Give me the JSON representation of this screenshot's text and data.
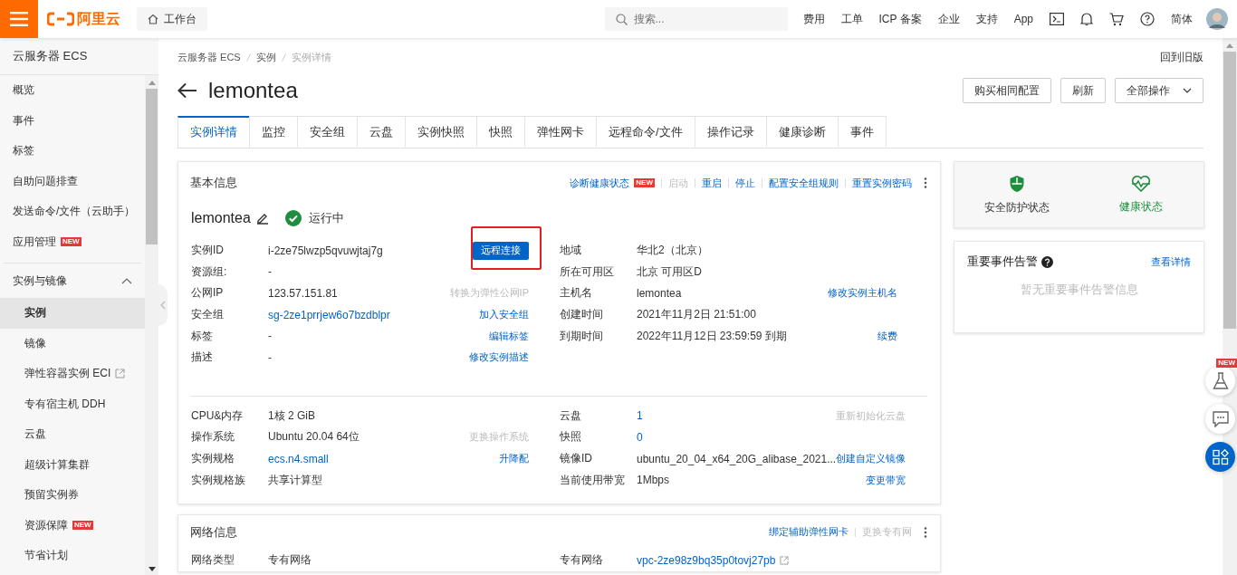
{
  "topbar": {
    "logo": "阿里云",
    "workbench": "工作台",
    "search": {
      "placeholder": "搜索..."
    },
    "links": [
      "费用",
      "工单",
      "ICP 备案",
      "企业",
      "支持",
      "App"
    ],
    "language": "简体"
  },
  "sidebar": {
    "title": "云服务器 ECS",
    "items": [
      {
        "label": "概览",
        "selected": false
      },
      {
        "label": "事件",
        "selected": false
      },
      {
        "label": "标签",
        "selected": false
      },
      {
        "label": "自助问题排查",
        "selected": false
      },
      {
        "label": "发送命令/文件（云助手）",
        "selected": false
      },
      {
        "label": "应用管理",
        "badge": "NEW",
        "selected": false
      }
    ],
    "group": {
      "label": "实例与镜像",
      "expanded": true,
      "children": [
        {
          "label": "实例",
          "selected": true
        },
        {
          "label": "镜像",
          "selected": false
        },
        {
          "label": "弹性容器实例 ECI",
          "external": true,
          "selected": false
        },
        {
          "label": "专有宿主机 DDH",
          "selected": false
        },
        {
          "label": "云盘",
          "selected": false
        },
        {
          "label": "超级计算集群",
          "selected": false
        },
        {
          "label": "预留实例券",
          "selected": false
        },
        {
          "label": "资源保障",
          "badge": "NEW",
          "selected": false
        },
        {
          "label": "节省计划",
          "selected": false
        }
      ]
    }
  },
  "breadcrumb": [
    "云服务器 ECS",
    "实例",
    "实例详情"
  ],
  "old_version_link": "回到旧版",
  "title": "lemontea",
  "header_buttons": [
    {
      "label": "购买相同配置",
      "dropdown": false
    },
    {
      "label": "刷新",
      "dropdown": false
    },
    {
      "label": "全部操作",
      "dropdown": true
    }
  ],
  "tabs": [
    {
      "label": "实例详情",
      "selected": true
    },
    {
      "label": "监控",
      "selected": false
    },
    {
      "label": "安全组",
      "selected": false
    },
    {
      "label": "云盘",
      "selected": false
    },
    {
      "label": "实例快照",
      "selected": false
    },
    {
      "label": "快照",
      "selected": false
    },
    {
      "label": "弹性网卡",
      "selected": false
    },
    {
      "label": "远程命令/文件",
      "selected": false
    },
    {
      "label": "操作记录",
      "selected": false
    },
    {
      "label": "健康诊断",
      "selected": false
    },
    {
      "label": "事件",
      "selected": false
    }
  ],
  "basic_info": {
    "title": "基本信息",
    "actions": [
      {
        "label": "诊断健康状态",
        "badge": "NEW",
        "disabled": false
      },
      {
        "label": "启动",
        "disabled": true
      },
      {
        "label": "重启",
        "disabled": false
      },
      {
        "label": "停止",
        "disabled": false
      },
      {
        "label": "配置安全组规则",
        "disabled": false
      },
      {
        "label": "重置实例密码",
        "disabled": false
      }
    ],
    "instance_name": "lemontea",
    "status": "运行中",
    "sections": [
      {
        "left": [
          {
            "label": "实例ID",
            "value": "i-2ze75lwzp5qvuwjtaj7g",
            "link": false,
            "action": {
              "kind": "button",
              "label": "远程连接",
              "highlighted": true,
              "disabled": false
            }
          },
          {
            "label": "资源组:",
            "value": "-",
            "link": false
          },
          {
            "label": "公网IP",
            "value": "123.57.151.81",
            "link": false,
            "action": {
              "kind": "link",
              "label": "转换为弹性公网IP",
              "disabled": true
            }
          },
          {
            "label": "安全组",
            "value": "sg-2ze1prrjew6o7bzdblpr",
            "link": true,
            "action": {
              "kind": "link",
              "label": "加入安全组",
              "disabled": false
            }
          },
          {
            "label": "标签",
            "value": "-",
            "link": false,
            "action": {
              "kind": "link",
              "label": "编辑标签",
              "disabled": false
            }
          },
          {
            "label": "描述",
            "value": "-",
            "link": false,
            "action": {
              "kind": "link",
              "label": "修改实例描述",
              "disabled": false
            }
          }
        ],
        "right": [
          {
            "label": "地域",
            "value": "华北2（北京）",
            "link": false
          },
          {
            "label": "所在可用区",
            "value": "北京 可用区D",
            "link": false
          },
          {
            "label": "主机名",
            "value": "lemontea",
            "link": false,
            "action": {
              "kind": "link",
              "label": "修改实例主机名",
              "disabled": false
            }
          },
          {
            "label": "创建时间",
            "value": "2021年11月2日 21:51:00",
            "link": false
          },
          {
            "label": "到期时间",
            "value": "2022年11月12日 23:59:59 到期",
            "link": false,
            "action": {
              "kind": "link",
              "label": "续费",
              "disabled": false
            }
          }
        ]
      },
      {
        "left": [
          {
            "label": "CPU&内存",
            "value": "1核 2 GiB",
            "link": false
          },
          {
            "label": "操作系统",
            "value": "Ubuntu 20.04 64位",
            "link": false,
            "action": {
              "kind": "link",
              "label": "更换操作系统",
              "disabled": true
            }
          },
          {
            "label": "实例规格",
            "value": "ecs.n4.small",
            "link": true,
            "action": {
              "kind": "link",
              "label": "升降配",
              "disabled": false
            }
          },
          {
            "label": "实例规格族",
            "value": "共享计算型",
            "link": false
          }
        ],
        "right": [
          {
            "label": "云盘",
            "value": "1",
            "link": true,
            "action": {
              "kind": "link",
              "label": "重新初始化云盘",
              "disabled": true
            }
          },
          {
            "label": "快照",
            "value": "0",
            "link": true
          },
          {
            "label": "镜像ID",
            "value": "ubuntu_20_04_x64_20G_alibase_2021...",
            "link": false,
            "action": {
              "kind": "link",
              "label": "创建自定义镜像",
              "disabled": false
            }
          },
          {
            "label": "当前使用带宽",
            "value": "1Mbps",
            "link": false,
            "action": {
              "kind": "link",
              "label": "变更带宽",
              "disabled": false
            }
          }
        ]
      }
    ]
  },
  "network_info": {
    "title": "网络信息",
    "actions": [
      {
        "label": "绑定辅助弹性网卡",
        "disabled": false
      },
      {
        "label": "更换专有网",
        "disabled": true
      }
    ],
    "left": [
      {
        "label": "网络类型",
        "value": "专有网络",
        "link": false
      }
    ],
    "right": [
      {
        "label": "专有网络",
        "value": "vpc-2ze98z9bq35p0tovj27pb",
        "link": true,
        "external": true
      }
    ]
  },
  "status_panel": [
    {
      "kind": "shield",
      "label": "安全防护状态",
      "active": false
    },
    {
      "kind": "heart",
      "label": "健康状态",
      "active": true
    }
  ],
  "events_panel": {
    "title": "重要事件告警",
    "link": "查看详情",
    "empty": "暂无重要事件告警信息"
  },
  "floating_buttons": [
    {
      "kind": "flask",
      "badge": "NEW"
    },
    {
      "kind": "chat"
    },
    {
      "kind": "apps"
    }
  ]
}
